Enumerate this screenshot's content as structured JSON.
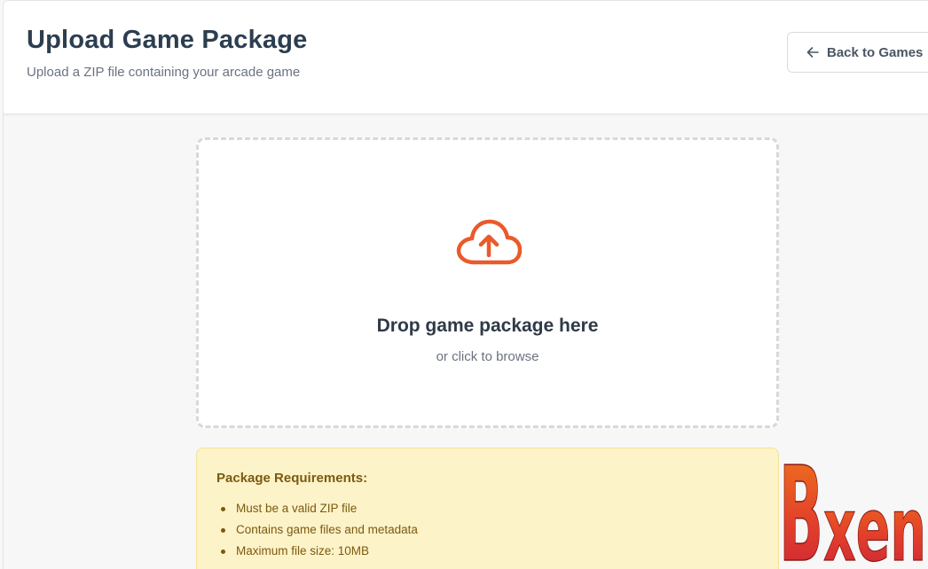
{
  "header": {
    "title": "Upload Game Package",
    "subtitle": "Upload a ZIP file containing your arcade game",
    "back_label": "Back to Games",
    "back_icon": "arrow-left-icon"
  },
  "dropzone": {
    "icon": "cloud-upload-icon",
    "title": "Drop game package here",
    "subtitle": "or click to browse"
  },
  "requirements": {
    "title": "Package Requirements:",
    "items": [
      "Must be a valid ZIP file",
      "Contains game files and metadata",
      "Maximum file size: 10MB"
    ]
  },
  "watermark": {
    "text": "Bxen"
  },
  "colors": {
    "accent": "#ea5a2a",
    "title": "#2c3e50",
    "requirements_bg": "#fdf3c8",
    "requirements_text": "#7a5a10"
  }
}
